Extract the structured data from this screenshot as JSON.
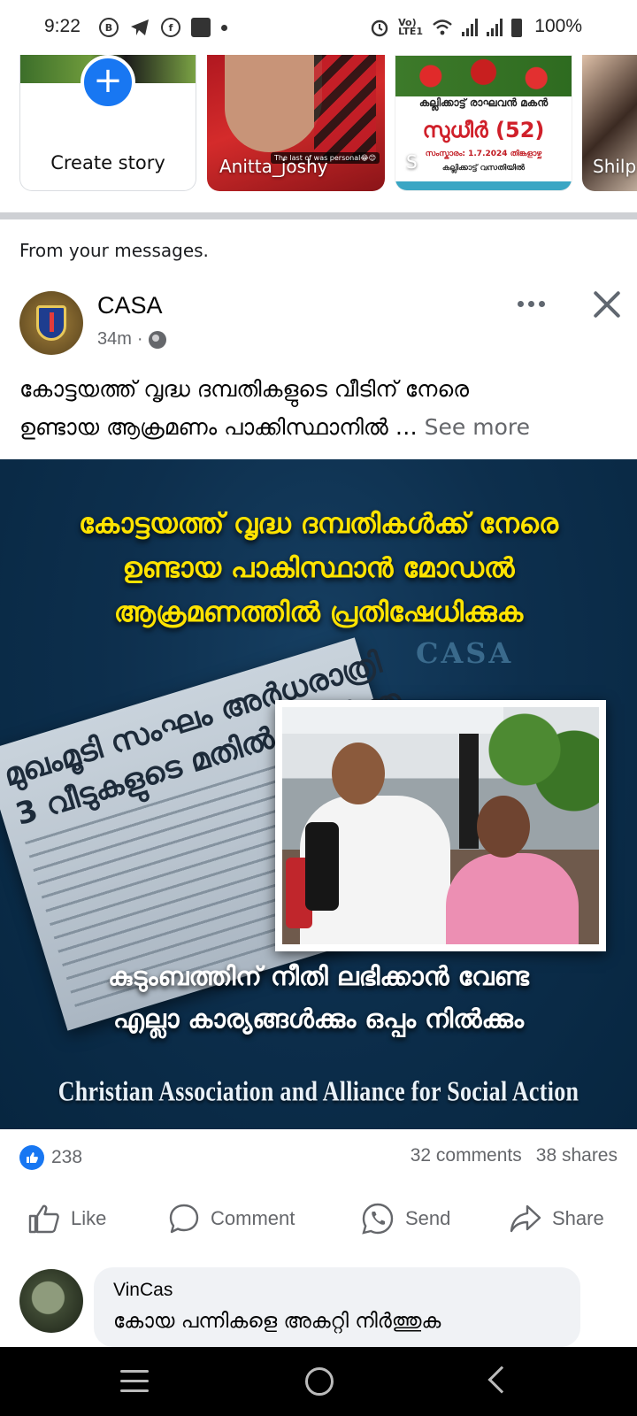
{
  "status_bar": {
    "time": "9:22",
    "battery": "100%",
    "icons": [
      "b-icon",
      "telegram-icon",
      "facebook-icon",
      "mail-icon",
      "dot-icon",
      "alarm-icon",
      "volte-icon",
      "wifi-icon",
      "signal-icon",
      "signal-icon",
      "battery-icon"
    ]
  },
  "stories": {
    "create_label": "Create story",
    "items": [
      {
        "name": "Anitta_joshy",
        "tag": "The last of was personal😂😊"
      },
      {
        "name": "S",
        "poster_line1": "കല്ലിക്കാട്ട് രാഘവൻ മകൻ",
        "poster_name": "സുധീർ (52)",
        "poster_line3": "സംസ്കാരം: 1.7.2024 തിങ്കളാഴ്ച",
        "poster_line4": "കല്ലിക്കാട്ട് വസതിയിൽ"
      },
      {
        "name": "Shilp"
      }
    ]
  },
  "post": {
    "from_label": "From your messages.",
    "author": "CASA",
    "time": "34m",
    "caption_line1": "കോട്ടയത്ത് വൃദ്ധ ദമ്പതികളുടെ വീടിന് നേരെ",
    "caption_line2": "ഉണ്ടായ ആക്രമണം പാക്കിസ്ഥാനിൽ …",
    "see_more": "See more",
    "image": {
      "headline_1": "കോട്ടയത്ത് വൃദ്ധ ദമ്പതികൾക്ക് നേരെ",
      "headline_2": "ഉണ്ടായ പാകിസ്ഥാൻ മോഡൽ",
      "headline_3": "ആക്രമണത്തിൽ പ്രതിഷേധിക്കുക",
      "watermark": "CASA",
      "newspaper_1": "മുഖംമൂടി സംഘം അർധരാത്രി",
      "newspaper_2": "3 വീടുകളുടെ മതിൽ തകർത്തു",
      "bottom_1": "കുടുംബത്തിന് നീതി ലഭിക്കാൻ വേണ്ട",
      "bottom_2": "എല്ലാ കാര്യങ്ങൾക്കും ഒപ്പം നിൽക്കും",
      "footer": "Christian Association and Alliance for Social Action"
    },
    "reaction_count": "238",
    "comments_count": "32 comments",
    "shares_count": "38 shares",
    "actions": {
      "like": "Like",
      "comment": "Comment",
      "send": "Send",
      "share": "Share"
    }
  },
  "comment": {
    "name": "VinCas",
    "text": "കോയ പന്നികളെ അകറ്റി നിർത്തുക"
  },
  "colors": {
    "accent": "#1877f2",
    "headline_yellow": "#ffe300",
    "image_background": "#0d2f4d",
    "secondary_text": "#65676b"
  }
}
